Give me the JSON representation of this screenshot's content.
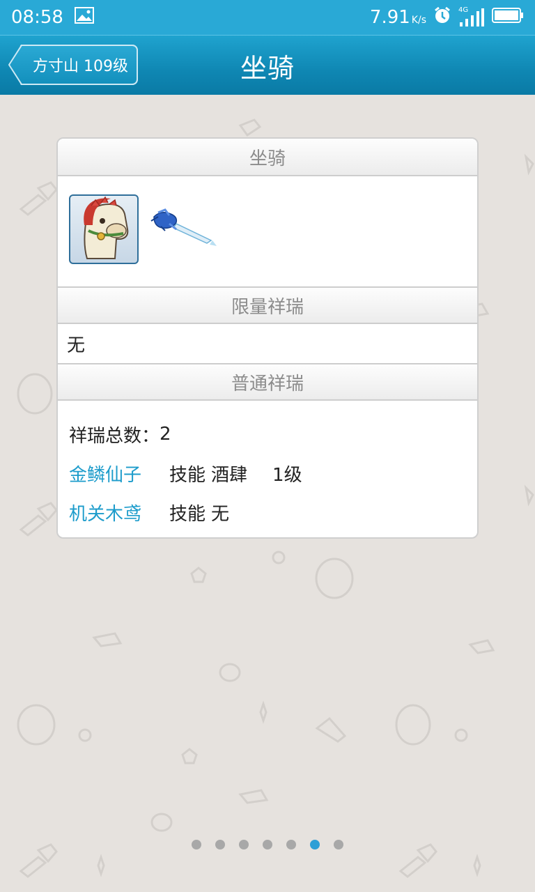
{
  "status_bar": {
    "time": "08:58",
    "speed": "7.91",
    "speed_unit": "K/s",
    "network": "4G"
  },
  "title_bar": {
    "back_label": "方寸山 109级",
    "title": "坐骑"
  },
  "card": {
    "mount_header": "坐骑",
    "limited_header": "限量祥瑞",
    "limited_value": "无",
    "common_header": "普通祥瑞",
    "total_label": "祥瑞总数：",
    "total_value": "2",
    "items": [
      {
        "name": "金鳞仙子",
        "skill_label": "技能",
        "skill": "酒肆",
        "level": "1级"
      },
      {
        "name": "机关木鸢",
        "skill_label": "技能",
        "skill": "无",
        "level": ""
      }
    ]
  },
  "pager": {
    "count": 7,
    "active_index": 5
  },
  "colors": {
    "accent": "#29a9d6",
    "link": "#1d9ccb",
    "background": "#e6e2de"
  }
}
